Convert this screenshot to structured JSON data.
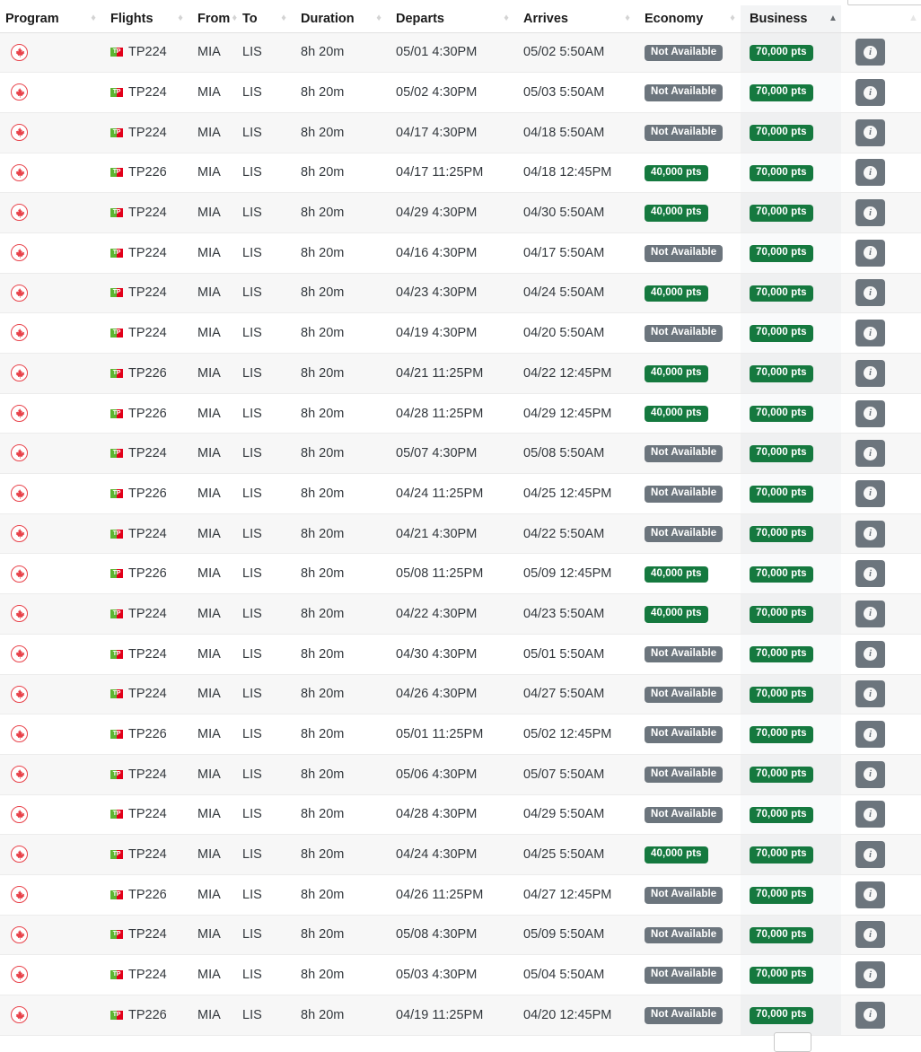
{
  "table": {
    "columns": [
      {
        "key": "program",
        "label": "Program",
        "sort": "none"
      },
      {
        "key": "flights",
        "label": "Flights",
        "sort": "none"
      },
      {
        "key": "from",
        "label": "From",
        "sort": "none"
      },
      {
        "key": "to",
        "label": "To",
        "sort": "none"
      },
      {
        "key": "duration",
        "label": "Duration",
        "sort": "none"
      },
      {
        "key": "departs",
        "label": "Departs",
        "sort": "none"
      },
      {
        "key": "arrives",
        "label": "Arrives",
        "sort": "none"
      },
      {
        "key": "economy",
        "label": "Economy",
        "sort": "none"
      },
      {
        "key": "business",
        "label": "Business",
        "sort": "asc"
      }
    ],
    "program_icon": "air-canada-maple-leaf-icon",
    "airline_icon": "tap-portugal-logo-icon",
    "info_icon": "info-icon",
    "not_available_label": "Not Available",
    "rows": [
      {
        "flight": "TP224",
        "from": "MIA",
        "to": "LIS",
        "duration": "8h 20m",
        "departs": "05/01 4:30PM",
        "arrives": "05/02 5:50AM",
        "economy": "Not Available",
        "economy_available": false,
        "business": "70,000 pts",
        "business_available": true
      },
      {
        "flight": "TP224",
        "from": "MIA",
        "to": "LIS",
        "duration": "8h 20m",
        "departs": "05/02 4:30PM",
        "arrives": "05/03 5:50AM",
        "economy": "Not Available",
        "economy_available": false,
        "business": "70,000 pts",
        "business_available": true
      },
      {
        "flight": "TP224",
        "from": "MIA",
        "to": "LIS",
        "duration": "8h 20m",
        "departs": "04/17 4:30PM",
        "arrives": "04/18 5:50AM",
        "economy": "Not Available",
        "economy_available": false,
        "business": "70,000 pts",
        "business_available": true
      },
      {
        "flight": "TP226",
        "from": "MIA",
        "to": "LIS",
        "duration": "8h 20m",
        "departs": "04/17 11:25PM",
        "arrives": "04/18 12:45PM",
        "economy": "40,000 pts",
        "economy_available": true,
        "business": "70,000 pts",
        "business_available": true
      },
      {
        "flight": "TP224",
        "from": "MIA",
        "to": "LIS",
        "duration": "8h 20m",
        "departs": "04/29 4:30PM",
        "arrives": "04/30 5:50AM",
        "economy": "40,000 pts",
        "economy_available": true,
        "business": "70,000 pts",
        "business_available": true
      },
      {
        "flight": "TP224",
        "from": "MIA",
        "to": "LIS",
        "duration": "8h 20m",
        "departs": "04/16 4:30PM",
        "arrives": "04/17 5:50AM",
        "economy": "Not Available",
        "economy_available": false,
        "business": "70,000 pts",
        "business_available": true
      },
      {
        "flight": "TP224",
        "from": "MIA",
        "to": "LIS",
        "duration": "8h 20m",
        "departs": "04/23 4:30PM",
        "arrives": "04/24 5:50AM",
        "economy": "40,000 pts",
        "economy_available": true,
        "business": "70,000 pts",
        "business_available": true
      },
      {
        "flight": "TP224",
        "from": "MIA",
        "to": "LIS",
        "duration": "8h 20m",
        "departs": "04/19 4:30PM",
        "arrives": "04/20 5:50AM",
        "economy": "Not Available",
        "economy_available": false,
        "business": "70,000 pts",
        "business_available": true
      },
      {
        "flight": "TP226",
        "from": "MIA",
        "to": "LIS",
        "duration": "8h 20m",
        "departs": "04/21 11:25PM",
        "arrives": "04/22 12:45PM",
        "economy": "40,000 pts",
        "economy_available": true,
        "business": "70,000 pts",
        "business_available": true
      },
      {
        "flight": "TP226",
        "from": "MIA",
        "to": "LIS",
        "duration": "8h 20m",
        "departs": "04/28 11:25PM",
        "arrives": "04/29 12:45PM",
        "economy": "40,000 pts",
        "economy_available": true,
        "business": "70,000 pts",
        "business_available": true
      },
      {
        "flight": "TP224",
        "from": "MIA",
        "to": "LIS",
        "duration": "8h 20m",
        "departs": "05/07 4:30PM",
        "arrives": "05/08 5:50AM",
        "economy": "Not Available",
        "economy_available": false,
        "business": "70,000 pts",
        "business_available": true
      },
      {
        "flight": "TP226",
        "from": "MIA",
        "to": "LIS",
        "duration": "8h 20m",
        "departs": "04/24 11:25PM",
        "arrives": "04/25 12:45PM",
        "economy": "Not Available",
        "economy_available": false,
        "business": "70,000 pts",
        "business_available": true
      },
      {
        "flight": "TP224",
        "from": "MIA",
        "to": "LIS",
        "duration": "8h 20m",
        "departs": "04/21 4:30PM",
        "arrives": "04/22 5:50AM",
        "economy": "Not Available",
        "economy_available": false,
        "business": "70,000 pts",
        "business_available": true
      },
      {
        "flight": "TP226",
        "from": "MIA",
        "to": "LIS",
        "duration": "8h 20m",
        "departs": "05/08 11:25PM",
        "arrives": "05/09 12:45PM",
        "economy": "40,000 pts",
        "economy_available": true,
        "business": "70,000 pts",
        "business_available": true
      },
      {
        "flight": "TP224",
        "from": "MIA",
        "to": "LIS",
        "duration": "8h 20m",
        "departs": "04/22 4:30PM",
        "arrives": "04/23 5:50AM",
        "economy": "40,000 pts",
        "economy_available": true,
        "business": "70,000 pts",
        "business_available": true
      },
      {
        "flight": "TP224",
        "from": "MIA",
        "to": "LIS",
        "duration": "8h 20m",
        "departs": "04/30 4:30PM",
        "arrives": "05/01 5:50AM",
        "economy": "Not Available",
        "economy_available": false,
        "business": "70,000 pts",
        "business_available": true
      },
      {
        "flight": "TP224",
        "from": "MIA",
        "to": "LIS",
        "duration": "8h 20m",
        "departs": "04/26 4:30PM",
        "arrives": "04/27 5:50AM",
        "economy": "Not Available",
        "economy_available": false,
        "business": "70,000 pts",
        "business_available": true
      },
      {
        "flight": "TP226",
        "from": "MIA",
        "to": "LIS",
        "duration": "8h 20m",
        "departs": "05/01 11:25PM",
        "arrives": "05/02 12:45PM",
        "economy": "Not Available",
        "economy_available": false,
        "business": "70,000 pts",
        "business_available": true
      },
      {
        "flight": "TP224",
        "from": "MIA",
        "to": "LIS",
        "duration": "8h 20m",
        "departs": "05/06 4:30PM",
        "arrives": "05/07 5:50AM",
        "economy": "Not Available",
        "economy_available": false,
        "business": "70,000 pts",
        "business_available": true
      },
      {
        "flight": "TP224",
        "from": "MIA",
        "to": "LIS",
        "duration": "8h 20m",
        "departs": "04/28 4:30PM",
        "arrives": "04/29 5:50AM",
        "economy": "Not Available",
        "economy_available": false,
        "business": "70,000 pts",
        "business_available": true
      },
      {
        "flight": "TP224",
        "from": "MIA",
        "to": "LIS",
        "duration": "8h 20m",
        "departs": "04/24 4:30PM",
        "arrives": "04/25 5:50AM",
        "economy": "40,000 pts",
        "economy_available": true,
        "business": "70,000 pts",
        "business_available": true
      },
      {
        "flight": "TP226",
        "from": "MIA",
        "to": "LIS",
        "duration": "8h 20m",
        "departs": "04/26 11:25PM",
        "arrives": "04/27 12:45PM",
        "economy": "Not Available",
        "economy_available": false,
        "business": "70,000 pts",
        "business_available": true
      },
      {
        "flight": "TP224",
        "from": "MIA",
        "to": "LIS",
        "duration": "8h 20m",
        "departs": "05/08 4:30PM",
        "arrives": "05/09 5:50AM",
        "economy": "Not Available",
        "economy_available": false,
        "business": "70,000 pts",
        "business_available": true
      },
      {
        "flight": "TP224",
        "from": "MIA",
        "to": "LIS",
        "duration": "8h 20m",
        "departs": "05/03 4:30PM",
        "arrives": "05/04 5:50AM",
        "economy": "Not Available",
        "economy_available": false,
        "business": "70,000 pts",
        "business_available": true
      },
      {
        "flight": "TP226",
        "from": "MIA",
        "to": "LIS",
        "duration": "8h 20m",
        "departs": "04/19 11:25PM",
        "arrives": "04/20 12:45PM",
        "economy": "Not Available",
        "economy_available": false,
        "business": "70,000 pts",
        "business_available": true
      }
    ]
  },
  "colors": {
    "badge_available": "#15793f",
    "badge_unavailable": "#6c757d",
    "program_red": "#e8424a",
    "tap_green": "#5cb531",
    "tap_red": "#e2001a",
    "sorted_column_bg": "#f3f4f5"
  }
}
